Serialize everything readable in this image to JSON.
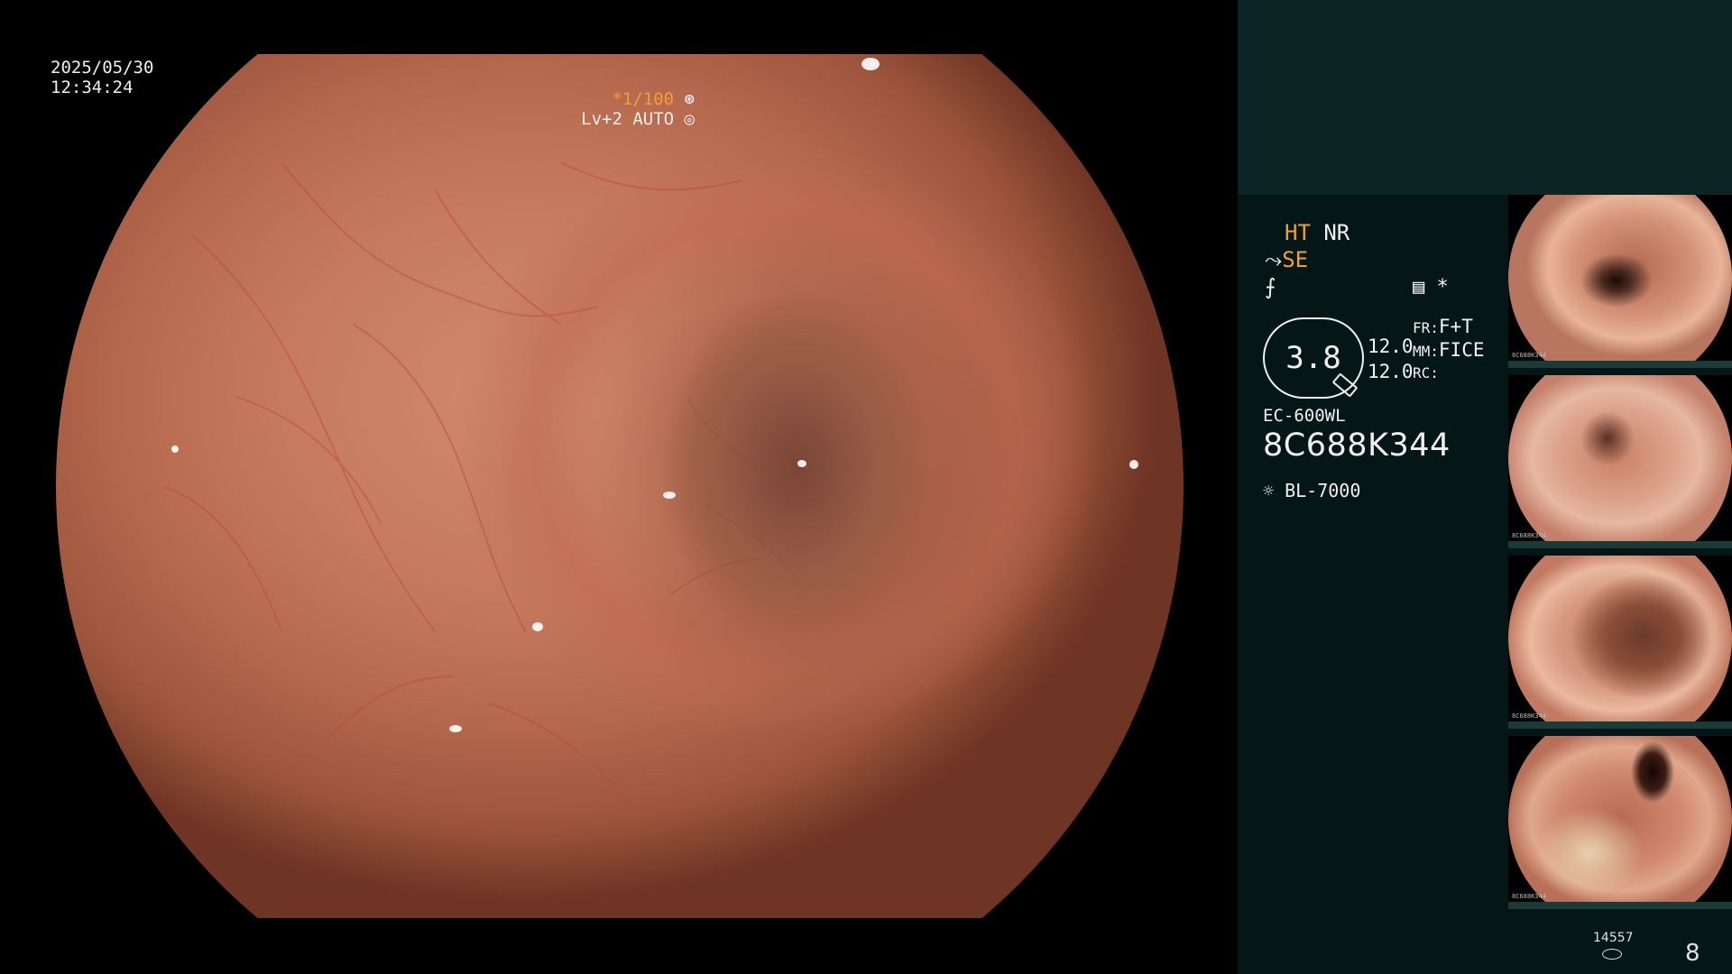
{
  "overlay": {
    "date": "2025/05/30",
    "time": "12:34:24",
    "shutter": "*1/100",
    "level": "Lv+2 AUTO"
  },
  "panel": {
    "tag_ht": "HT",
    "tag_nr": "NR",
    "tag_se": "SE",
    "ratio": "3.8",
    "val1": "12.0",
    "val2": "12.0",
    "label_fr": "FR:",
    "value_fr": "F+T",
    "label_mm": "MM:",
    "value_mm": "FICE",
    "label_rc": "RC:",
    "star": "*",
    "scope_model": "EC-600WL",
    "serial": "8C688K344",
    "light_source": "BL-7000"
  },
  "thumbnails": [
    {
      "caption": "8C688K344"
    },
    {
      "caption": "8C688K344"
    },
    {
      "caption": "8C688K344"
    },
    {
      "caption": "8C688K344"
    }
  ],
  "footer": {
    "capacity": "14557",
    "count": "8"
  },
  "colors": {
    "accent": "#f0a030",
    "panel_bg": "#041716",
    "panel_top": "#0b2424"
  }
}
